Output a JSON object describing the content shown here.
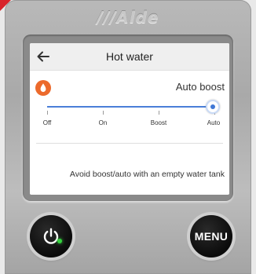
{
  "device": {
    "brand": "///Alde"
  },
  "screen": {
    "title": "Hot water",
    "status_label": "Auto boost",
    "slider": {
      "stops": [
        "Off",
        "On",
        "Boost",
        "Auto"
      ],
      "selected": "Auto",
      "accent_color": "#3f77d6"
    },
    "warning": "Avoid boost/auto with an empty water tank"
  },
  "controls": {
    "menu_label": "MENU",
    "power_led_color": "#34d23e"
  },
  "icons": {
    "back": "left-arrow-icon",
    "drop": "water-drop-icon",
    "power": "power-icon"
  }
}
